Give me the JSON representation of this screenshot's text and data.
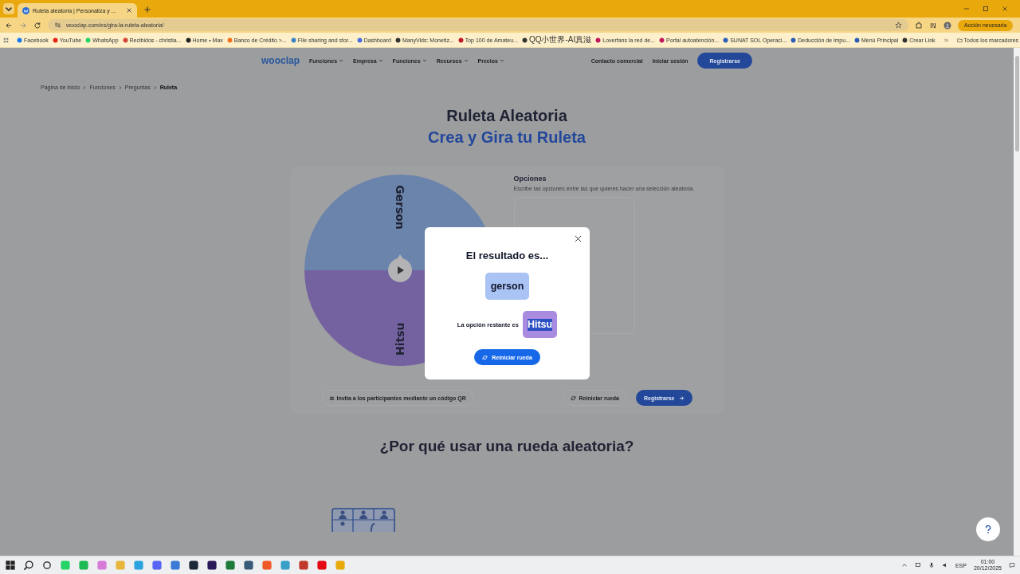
{
  "browser": {
    "tabs": [
      {
        "title": "Ruleta aleatoria | Personaliza y ...",
        "selected": true
      }
    ],
    "address": "wooclap.com/es/gira-la-ruleta-aleatoria/",
    "action_button": "Acción necesaria",
    "bookmarks": [
      {
        "label": "Facebook"
      },
      {
        "label": "YouTube"
      },
      {
        "label": "WhatsApp"
      },
      {
        "label": "Recibidos - christia..."
      },
      {
        "label": "Home • Max"
      },
      {
        "label": "Banco de Crédito >..."
      },
      {
        "label": "File sharing and stor..."
      },
      {
        "label": "Dashboard"
      },
      {
        "label": "ManyVids: Monetiz..."
      },
      {
        "label": "Top 100 de Amateu..."
      },
      {
        "label": "QQ小世界-AI真滋"
      },
      {
        "label": "Loverfans la red de..."
      },
      {
        "label": "Portal autoatención..."
      },
      {
        "label": "SUNAT SOL Operaci..."
      },
      {
        "label": "Deducción de impu..."
      },
      {
        "label": "Menú Principal"
      },
      {
        "label": "Crear Link"
      }
    ],
    "all_bookmarks": "Todos los marcadores"
  },
  "nav": {
    "logo": "wooclap",
    "menu": [
      "Funciones",
      "Empresa",
      "Funciones",
      "Recursos",
      "Precios"
    ],
    "links": [
      "Contacto comercial",
      "Iniciar sesión"
    ],
    "cta": "Registrarse"
  },
  "breadcrumb": [
    "Página de inicio",
    "Funciones",
    "Preguntas",
    "Ruleta"
  ],
  "title": "Ruleta Aleatoria",
  "subtitle": "Crea y Gira tu Ruleta",
  "wheel": {
    "segments": [
      {
        "label": "Gerson",
        "color": "#6b84ab"
      },
      {
        "label": "Hitsu",
        "color": "#7462a0"
      }
    ]
  },
  "options": {
    "title": "Opciones",
    "description": "Escribe las opciones entre las que quieres hacer una selección aleatoria."
  },
  "actions": {
    "invite": "Invita a los participantes mediante un código QR",
    "reset": "Reiniciar rueda",
    "register": "Registrarse"
  },
  "section_heading": "¿Por qué usar una rueda aleatoria?",
  "modal": {
    "title": "El resultado es...",
    "result": "gerson",
    "remaining_label": "La opción restante es",
    "remaining": "Hitsu",
    "button": "Reiniciar rueda"
  },
  "taskbar": {
    "language": "ESP",
    "time": "01:00",
    "date": "20/12/2025"
  }
}
